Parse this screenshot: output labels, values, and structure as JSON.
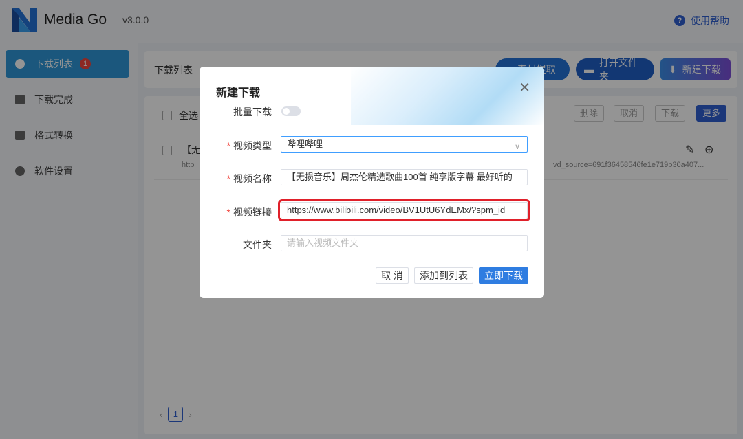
{
  "app": {
    "name": "Media Go",
    "version": "v3.0.0",
    "help_label": "使用帮助"
  },
  "sidebar": {
    "items": [
      {
        "label": "下载列表",
        "badge": "1"
      },
      {
        "label": "下载完成"
      },
      {
        "label": "格式转换"
      },
      {
        "label": "软件设置"
      }
    ]
  },
  "toolbar": {
    "title": "下载列表",
    "extract_label": "素材提取",
    "open_folder_label": "打开文件夹",
    "new_download_label": "新建下载"
  },
  "list": {
    "select_all_label": "全选",
    "actions": [
      "删除",
      "取消",
      "下载",
      "更多"
    ],
    "row_title": "【无",
    "row_url": "http",
    "row_url_tail": "vd_source=691f36458546fe1e719b30a407..."
  },
  "pager": {
    "current_page": "1"
  },
  "dialog": {
    "title": "新建下载",
    "batch_label": "批量下载",
    "type_label": "视频类型",
    "type_value": "哔哩哔哩",
    "name_label": "视频名称",
    "name_value": "【无损音乐】周杰伦精选歌曲100首 纯享版字幕 最好听的",
    "link_label": "视频链接",
    "link_value": "https://www.bilibili.com/video/BV1UtU6YdEMx/?spm_id",
    "folder_label": "文件夹",
    "folder_placeholder": "请输入视频文件夹",
    "cancel_label": "取 消",
    "add_label": "添加到列表",
    "download_label": "立即下载"
  }
}
